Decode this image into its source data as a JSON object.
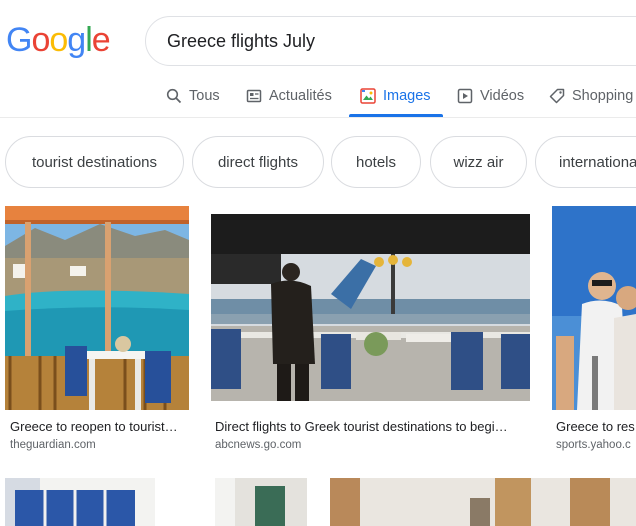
{
  "logo": {
    "letters": [
      "G",
      "o",
      "o",
      "g",
      "l",
      "e"
    ],
    "colors": [
      "#4285f4",
      "#ea4335",
      "#fbbc05",
      "#4285f4",
      "#34a853",
      "#ea4335"
    ]
  },
  "search": {
    "query": "Greece flights July"
  },
  "tabs": [
    {
      "label": "Tous",
      "icon": "search-icon"
    },
    {
      "label": "Actualités",
      "icon": "news-icon"
    },
    {
      "label": "Images",
      "icon": "images-icon",
      "active": true
    },
    {
      "label": "Vidéos",
      "icon": "video-icon"
    },
    {
      "label": "Shopping",
      "icon": "tag-icon"
    }
  ],
  "chips": [
    "tourist destinations",
    "direct flights",
    "hotels",
    "wizz air",
    "international"
  ],
  "results": [
    {
      "caption": "Greece to reopen to tourist…",
      "source": "theguardian.com"
    },
    {
      "caption": "Direct flights to Greek tourist destinations to begi…",
      "source": "abcnews.go.com"
    },
    {
      "caption": "Greece to res",
      "source": "sports.yahoo.c"
    }
  ],
  "colors": {
    "accent": "#1a73e8",
    "text": "#202124",
    "muted": "#5f6368",
    "border": "#dadce0"
  }
}
